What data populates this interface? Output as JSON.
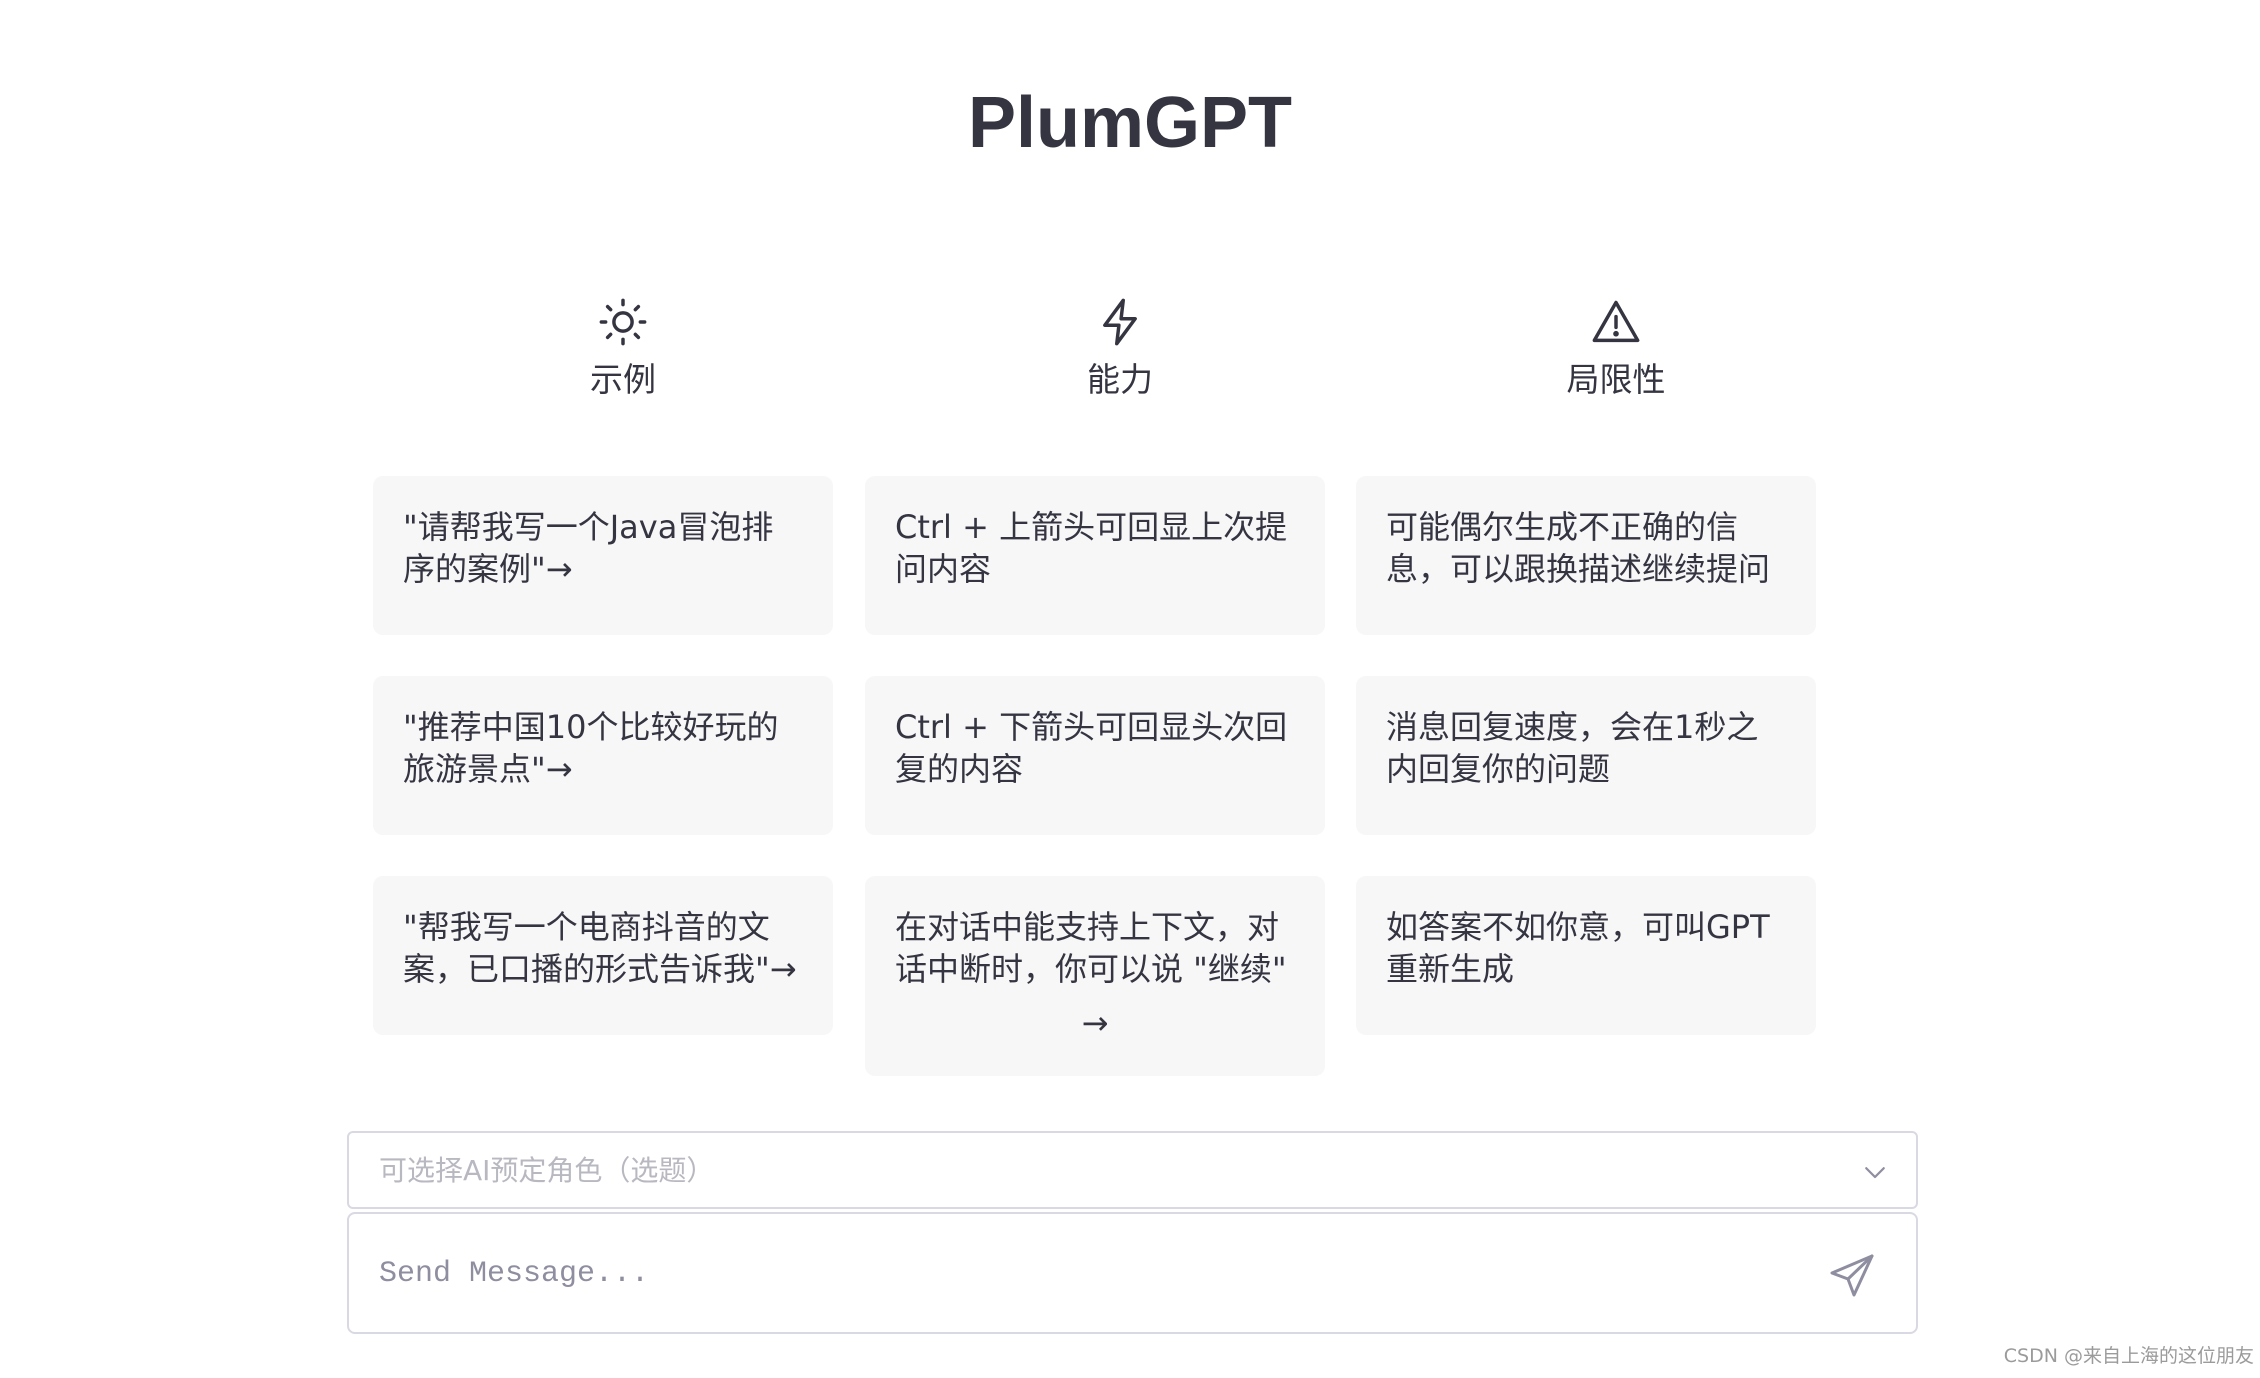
{
  "app": {
    "title": "PlumGPT"
  },
  "columns": [
    {
      "icon": "sun-icon",
      "label": "示例",
      "cards": [
        "\"请帮我写一个Java冒泡排序的案例\"→",
        "\"推荐中国10个比较好玩的旅游景点\"→",
        "\"帮我写一个电商抖音的文案，已口播的形式告诉我\"→"
      ]
    },
    {
      "icon": "lightning-icon",
      "label": "能力",
      "cards": [
        "Ctrl + 上箭头可回显上次提问内容",
        "Ctrl + 下箭头可回显头次回复的内容",
        "在对话中能支持上下文，对话中断时，你可以说 \"继续\""
      ],
      "last_card_arrow": "→"
    },
    {
      "icon": "warning-triangle-icon",
      "label": "局限性",
      "cards": [
        "可能偶尔生成不正确的信息，可以跟换描述继续提问",
        "消息回复速度，会在1秒之内回复你的问题",
        "如答案不如你意，可叫GPT重新生成"
      ]
    }
  ],
  "role_select": {
    "placeholder": "可选择AI预定角色（选题）",
    "icon": "chevron-down-icon"
  },
  "message": {
    "placeholder": "Send Message...",
    "send_icon": "paper-plane-icon"
  },
  "watermark": "CSDN @来自上海的这位朋友",
  "colors": {
    "text": "#343541",
    "card_bg": "#f7f7f8",
    "border": "#d9d9e3",
    "placeholder": "#b8b8c0"
  }
}
